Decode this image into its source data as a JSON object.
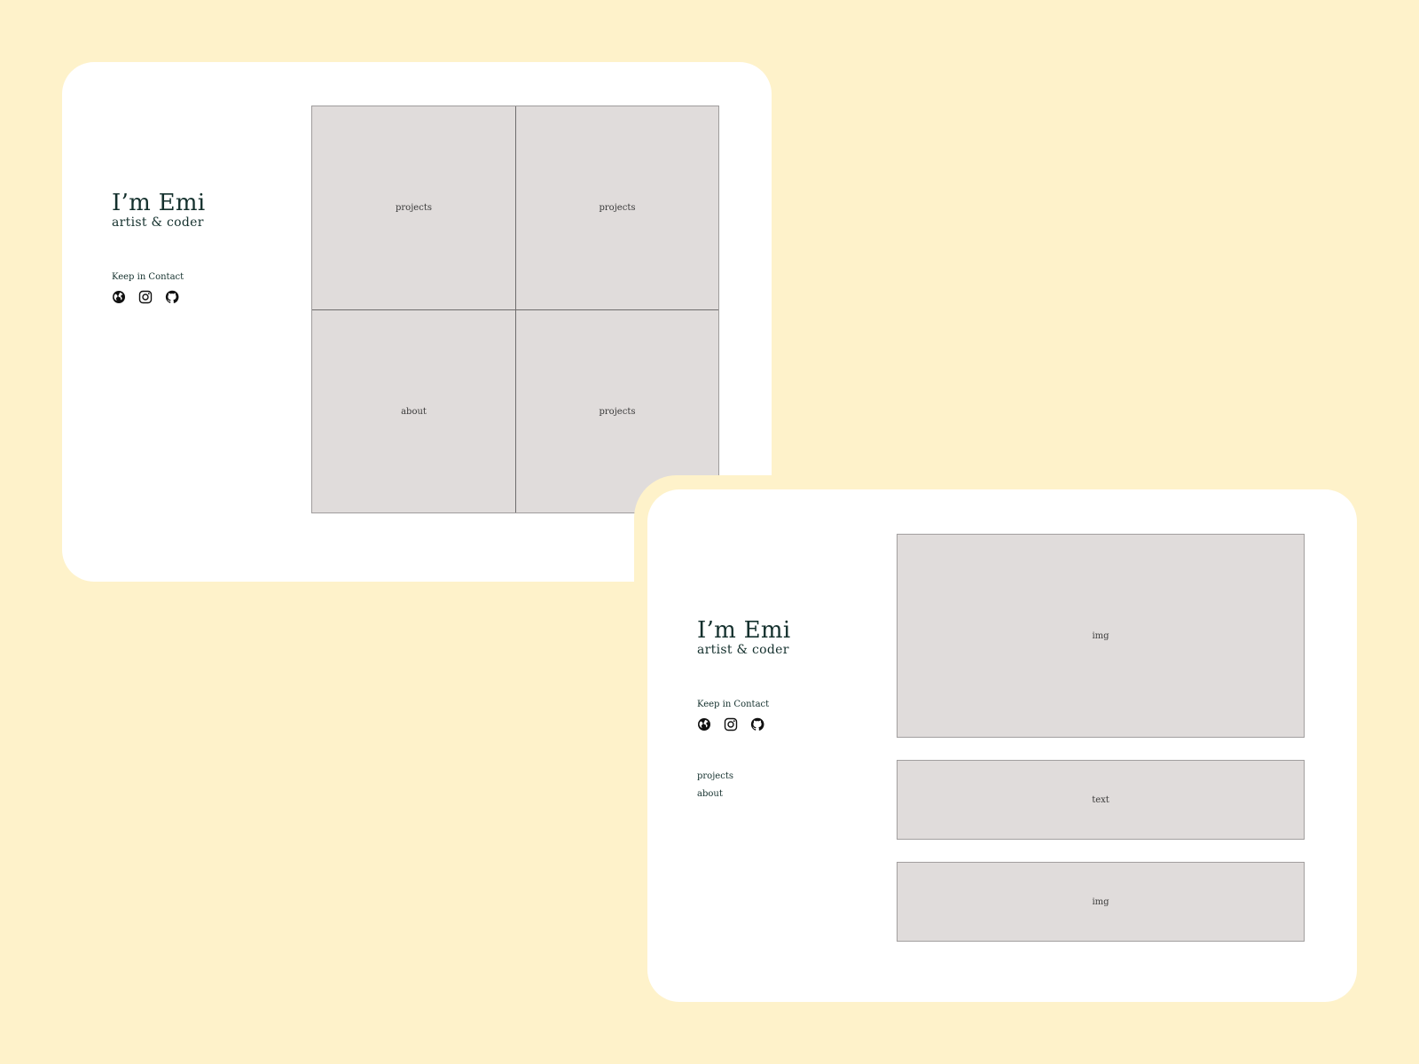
{
  "colors": {
    "background": "#fef2ca",
    "card": "#ffffff",
    "placeholder": "#e0dcdb",
    "text": "#14302d"
  },
  "home": {
    "brand": {
      "name": "I’m Emi",
      "tagline": "artist & coder"
    },
    "contact": {
      "label": "Keep in Contact",
      "icons": [
        "globe-icon",
        "instagram-icon",
        "github-icon"
      ]
    },
    "tiles": [
      "projects",
      "projects",
      "about",
      "projects"
    ]
  },
  "detail": {
    "brand": {
      "name": "I’m Emi",
      "tagline": "artist & coder"
    },
    "contact": {
      "label": "Keep in Contact",
      "icons": [
        "globe-icon",
        "instagram-icon",
        "github-icon"
      ]
    },
    "nav": [
      "projects",
      "about"
    ],
    "blocks": [
      "img",
      "text",
      "img"
    ]
  }
}
